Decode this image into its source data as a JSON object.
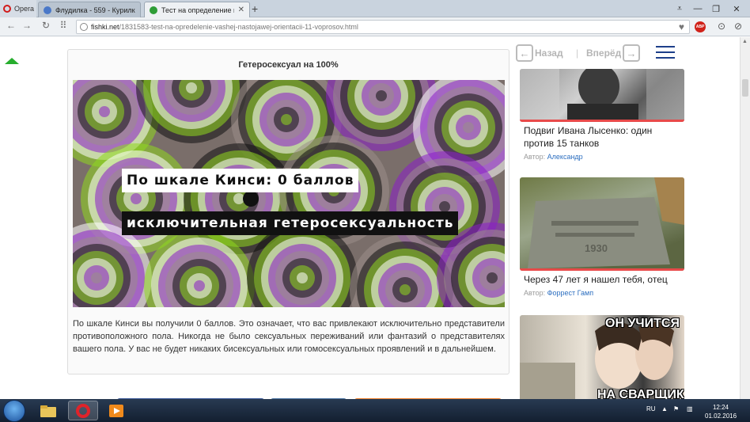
{
  "browser": {
    "menu_label": "Opera",
    "tabs": [
      {
        "label": "Флудилка - 559 - Курилк",
        "active": false,
        "favicon_color": "#4a78c8"
      },
      {
        "label": "Тест на определение ваш",
        "active": true,
        "favicon_color": "#2e9d37"
      }
    ],
    "new_tab_label": "+",
    "url_domain": "fishki.net",
    "url_path": "/1831583-test-na-opredelenie-vashej-nastojawej-orientacii-11-voprosov.html",
    "adblock_label": "ABP"
  },
  "content": {
    "card_title": "Гетеросексуал на 100%",
    "image_banner_1": "По шкале Кинси: 0 баллов",
    "image_banner_2": "исключительная гетеросексуальность",
    "description": "По шкале Кинси вы получили 0 баллов. Это означает, что вас привлекают исключительно представители противоположного пола. Никогда не было сексуальных переживаний или фантазий о представителях вашего пола. У вас не будет никаких бисексуальных или гомосексуальных проявлений и в дальнейшем."
  },
  "sidebar": {
    "back_label": "Назад",
    "forward_label": "Вперёд",
    "articles": [
      {
        "title": "Подвиг Ивана Лысенко: один против 15 танков",
        "author_prefix": "Автор:",
        "author": "Александр"
      },
      {
        "title": "Через 47 лет я нашел тебя, отец",
        "author_prefix": "Автор:",
        "author": "Форрест Гамп",
        "image_text": "1930"
      },
      {
        "image_text_top": "ОН УЧИТСЯ",
        "image_text_bottom": "НА СВАРЩИК"
      }
    ]
  },
  "taskbar": {
    "language": "RU",
    "time": "12:24",
    "date": "01.02.2016"
  },
  "colors": {
    "accent_green": "#27ae2e",
    "link_blue": "#2d6fc0",
    "nav_blue": "#1d3f8a",
    "image_purple": "#8a1ec8",
    "image_green": "#8fd81e"
  }
}
